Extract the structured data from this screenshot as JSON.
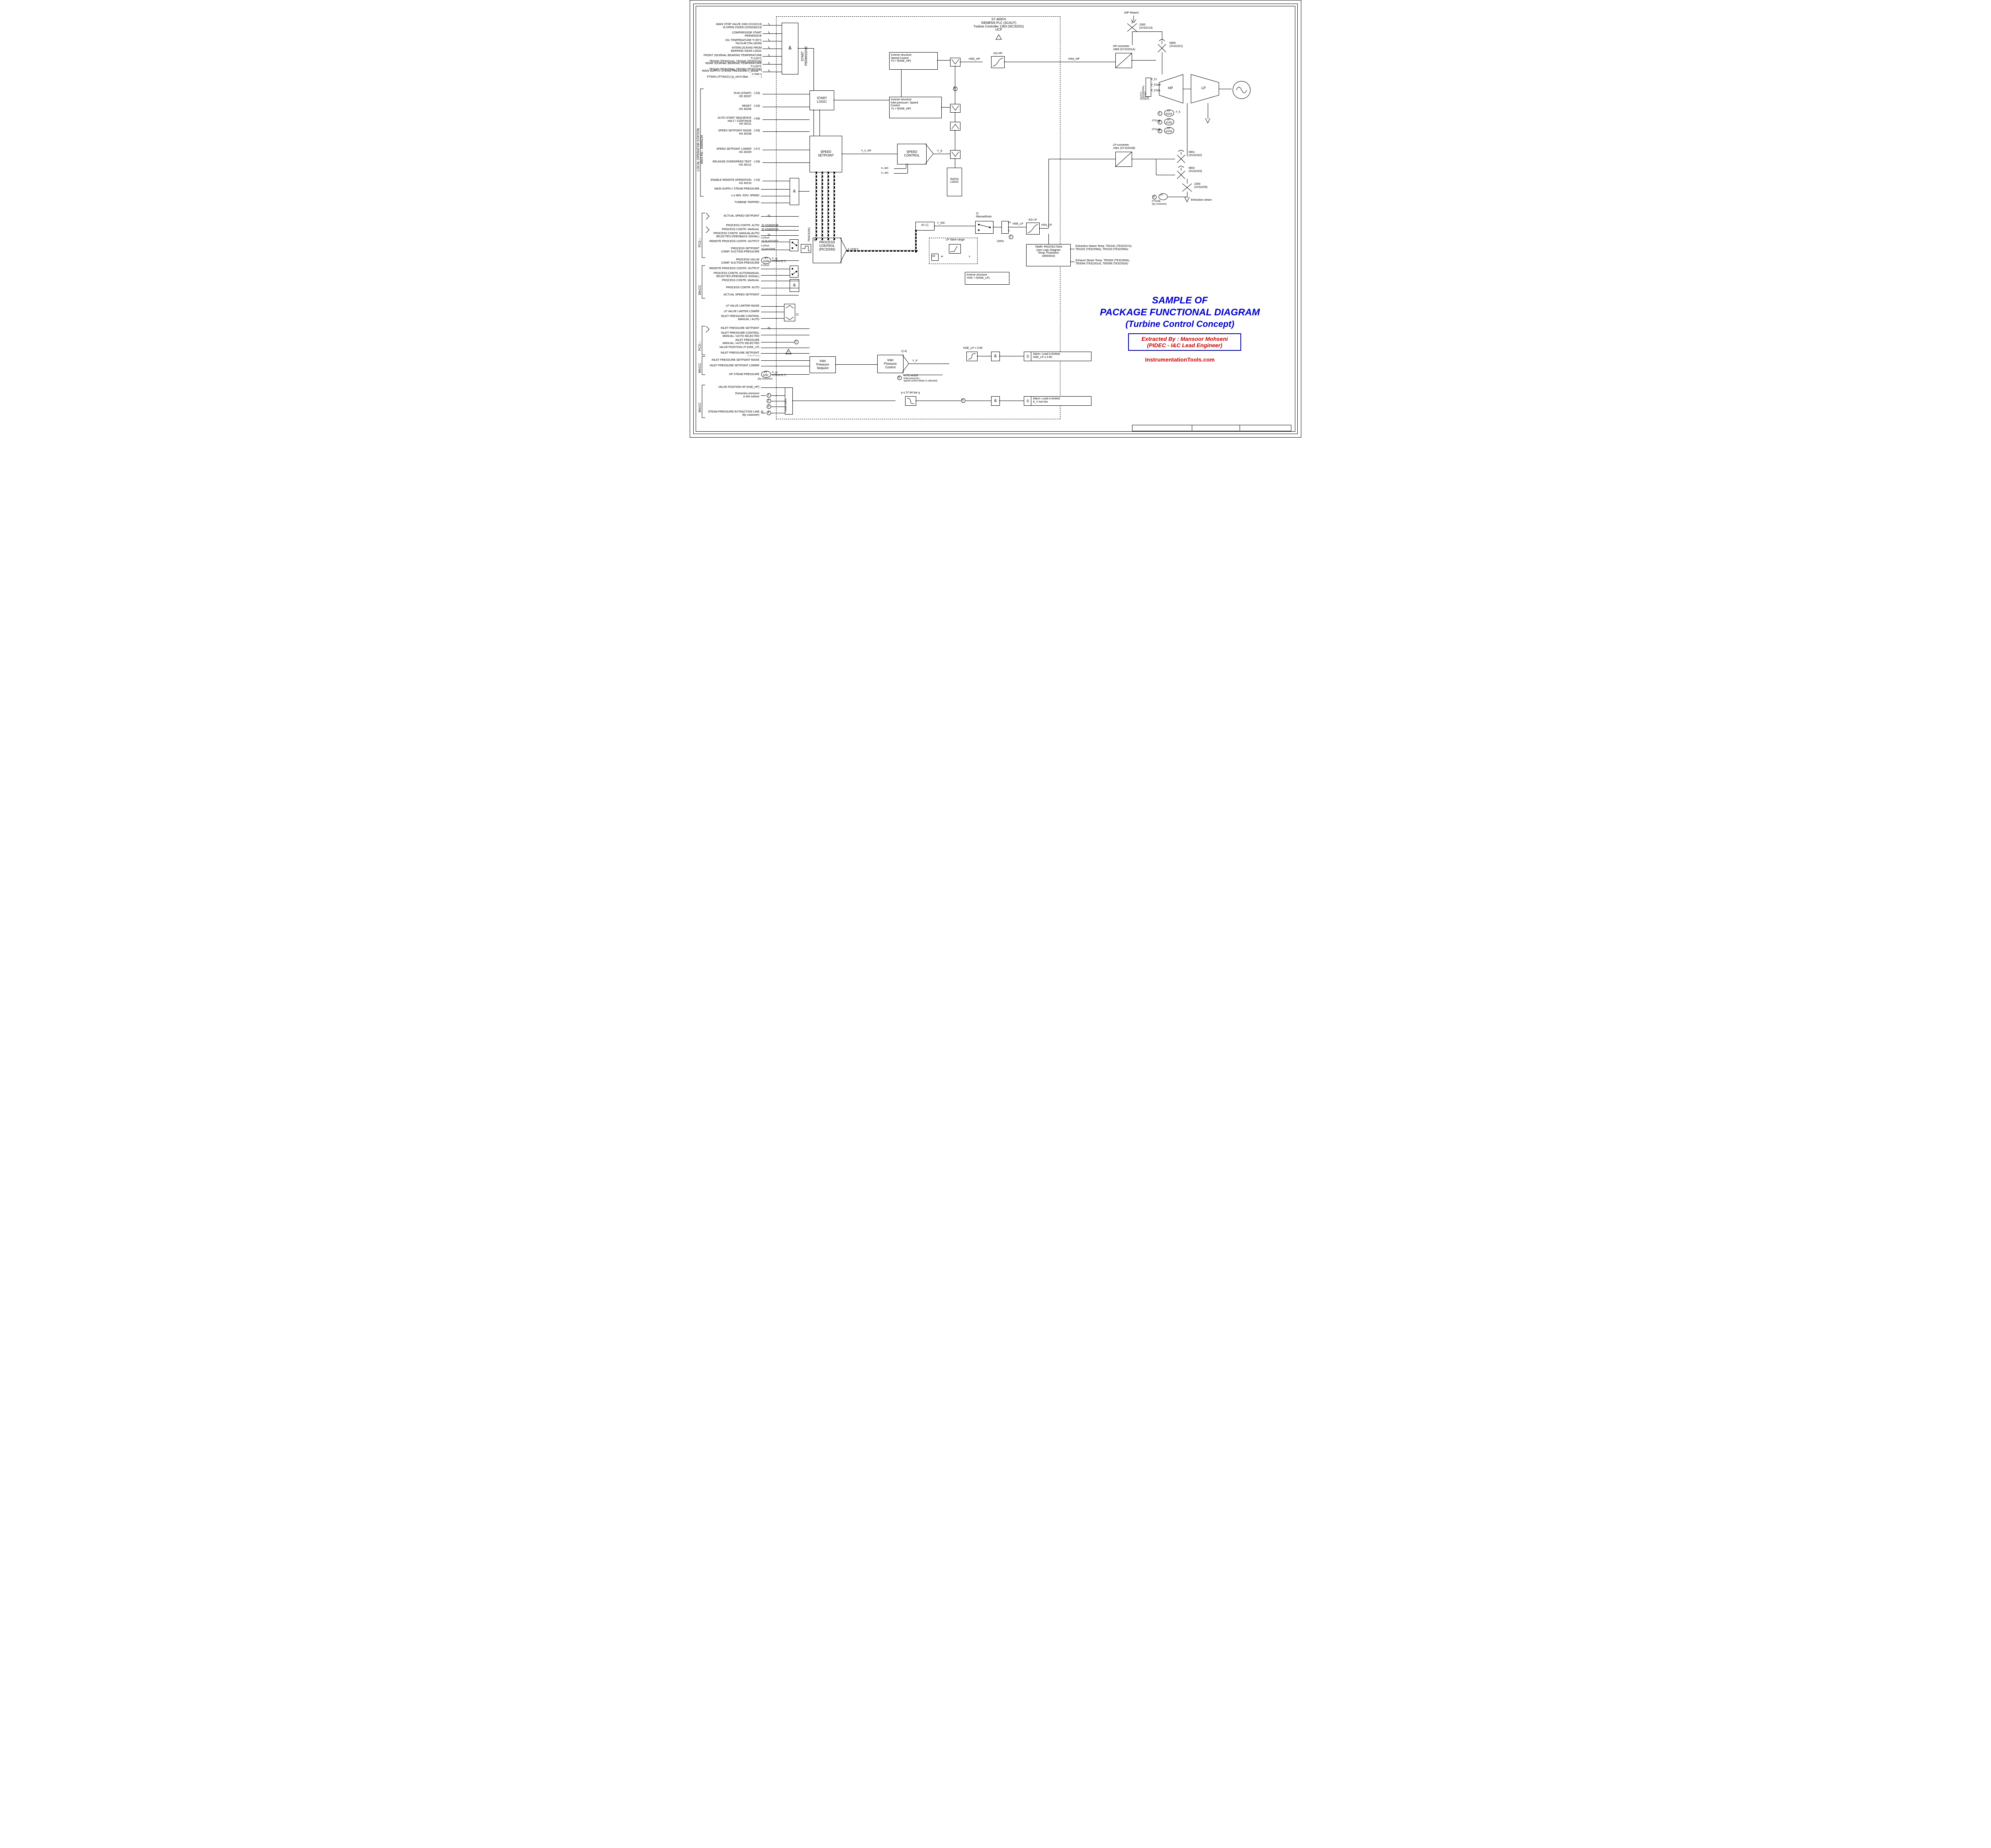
{
  "header": {
    "plc": "S7-400FH",
    "system": "SIEMENS PLC  (SCAUT)",
    "controller": "Turbine Controller 1350  (SIC32201)",
    "ucp": "UCP"
  },
  "permissives": {
    "p1": "MAIN STOP VALVE 2300 (XV32213)\nIS OPEN ZSO05 (XZSO30213)",
    "p2": "COMPRESSOR START\nPERMISSIVE",
    "p3": "OIL TEMPERATURE   T<35°C\nTAL5148  (TAL16249)",
    "p4": "INTERLOCKING FROM\nBARRING GEAR LOGIC",
    "p5": "FRONT JOURNAL BEARING TEMPERATURE   T<120°C\nTE0245 (TE30211A), TE0246 (TE30212A)",
    "p6": "REAR JOURNAL BEARING TEMPERATURE   T<120°C\nTE0249 (TE30209A), TE0250 (TE30210A)",
    "p7": "MAIN SUPPLY STEAM PRESSURE   n_actual * t s·max·s\nPT0001 (PT30221)  (p_rel<0.5bar · · · · · · · )",
    "vtext": "START\nPERMISSIVE"
  },
  "los": {
    "section": "LOCAL OPERATOR STATION",
    "ident": "Ident-No.: 16694216",
    "s1": "RUN (START)\nHS 30207",
    "s1tag": "(-S5)",
    "s2": "RESET\nHS 30206",
    "s2tag": "(-S4)",
    "s3": "AUTO START SEQUENCE\nHALT / CONTINUE\nHS 30211",
    "s3tag": "(-S8)",
    "s4": "SPEED SETPOINT RAISE\nHS 30208",
    "s4tag": "(-S6)",
    "s5": "SPEED SETPOINT LOWER\nHS 30209",
    "s5tag": "(-S7)",
    "s6": "RELEASE OVERSPEED TEST\nHS 30212",
    "s6tag": "(-S9)",
    "s7": "ENABLE REMOTE OPERATION\nHS 30210",
    "s7tag": "(-S3)",
    "mss": "MAIN SUPPLY STEAM PRESSURE",
    "ngov": "n ≥ MIN. GOV. SPEED",
    "trip": "TURBINE TRIPPED"
  },
  "blocks": {
    "start_logic": "START\nLOGIC",
    "speed_setpoint": "SPEED\nSETPOINT",
    "speed_control": "SPEED\nCONTROL",
    "ratio": "RATIO\nLOGIC",
    "hic": "H I C",
    "process_control": "PROCESS\nCONTROL\n(PIC32260)",
    "inlet_setpoint": "Inlet\nPressure\nSetpoint",
    "inlet_control": "Inlet\nPressure\nControl",
    "inv_speed": "Inverse structure\nSpeed Control\nYs = f(HSE_HP)",
    "inv_inlet": "Inverse structure\nInlet pressure / Speed\nControl\nYs = f(HSE_HP)",
    "inv_lp": "Inverse structure\nYHIC = f(HSE_LP)",
    "temp_prot": "TEMP. PROTECTION\n(see Logic Diagram\nTemp. Protection\n16693916)",
    "kg_hp": "KG-HP",
    "kg_lp": "KG-LP",
    "hp_conv": "HP-converter\n1680 (SY32201A)",
    "lp_conv": "LP-converter\n1681 (SY32201B)",
    "lp_valve_range": "LP Valve range",
    "pleast_select": "Pleast select",
    "auto_mode": "AUTO MODE\n(inlet pressure /\nspeed control  Mode is selected)",
    "alarm1": "Alarm: Load is limited;\nHSE_LP ≥ 0.95",
    "alarm2": "Alarm: Load is limited;\nA_V too low",
    "manual_auto": "2)\nManual/Auto",
    "tracking": "TRACKING"
  },
  "pcs": {
    "pcs2": "PCS↑↓",
    "wincc": "WinCC",
    "a1": "ACTUAL SPEED SETPOINT",
    "a2": "PROCESS CONTR. AUTO",
    "a3": "PROCESS CONTR. MANUAL",
    "a4": "PROCESS CONTR. MANUAL/AUTO\nSELECTED (FEEDBACK SIGNAL)",
    "a5": "REMOTE PROCESS CONTR. OUTPUT",
    "a6": "PROCESS SETPOINT\nCOMP. SUCTION PRESSURE",
    "a7": "PROCESS VALUE\nCOMP. SUCTION PRESSURE",
    "a8": "REMOTE PROCESS CONTR. OUTPUT",
    "a9": "PROCESS CONTR. AUTO/MANUAL\nSELECTED (FEEDBACK SIGNAL)",
    "a10": "PROCESS CONTR. MANUAL",
    "a11": "PROCESS CONTR. AUTO",
    "a12": "ACTUAL SPEED SETPOINT",
    "a2tag": "5) XS30257B",
    "a3tag": "5) XS30257A",
    "a5tag": "5) 9) HY3207",
    "a6tag": "5) HY3206",
    "a7tag_pt": "PT\n30266",
    "a7tag_txt": "P_sp\n4-20mA   5) 7)",
    "sig_420": "4-20mA"
  },
  "lp": {
    "l1": "LP VALVE LIMITER RAISE",
    "l2": "LP VALVE LIMITER LOWER",
    "l3": "INLET PRESSURE CONTROL\nMANUAL / AUTO",
    "l4": "INLET PRESSURE SETPOINT",
    "l5": "INLET PRESSURE CONTROL\nMANUAL / AUTO SELECTED",
    "l6": "INLET PRESSURE\nMANUAL / AUTO SELECTED",
    "l7": "VALVE POSITION LP (HSE_LP)",
    "l8": "INLET PRESSURE SETPOINT",
    "l8sub": "(Inlet Press)",
    "l9": "INLET PRESSURE SETPOINT RAISE",
    "l10": "INLET PRESSURE SETPOINT LOWER",
    "l11": "HP STEAM PRESSURE",
    "l11pt": "PT\n3250",
    "l11sub": "(by customer)",
    "l11sig": "P_sp\n4-20mA   5) 7)"
  },
  "ext": {
    "v1": "VALVE POSITION HP (HSE_HP)",
    "v2": "Extraction pressure\nin the turbine",
    "v3": "STEAM PRESSURE EXTRACTION LINE\n(by customer)",
    "bar": "p ≤ 37.84 bar g"
  },
  "right": {
    "hp_steam": "(HP-Steam)",
    "xv2300": "2300\n(XV32213)",
    "sv0800": "0800\n(SV32201)",
    "sv0801": "0801\n(SV32202)",
    "sv0802": "0802\n(SV32203)",
    "xv2350": "2350\n(XV32205)",
    "ext_steam": "Extraction steam",
    "pe1": "P_E1",
    "pe2": "P_E2WK",
    "pe3": "P_E2WL",
    "se": "SE/PLC\n(SE030200A)\nSE0262\n(SE030200B)",
    "hp": "HP",
    "lp_lbl": "LP",
    "pt1": "PT\n30254",
    "pt1n": "1",
    "pt1e": "P_E",
    "pt2": "PT\n30255",
    "pt2n": "2",
    "pt3": "PT\n30256",
    "pt3n": "3",
    "pt0162": "PT0162",
    "pt0163": "PT0163",
    "pt0256": "PT0256\n(by customer)",
    "pt0256n": "4",
    "ext_temp": "Extraction Steam Temp. TE0161 (TE32257A),\nTE0162 (TE32258A), TE0163 (TE32259A)",
    "exh_temp": "Exhaust Steam Temp. TE0093 (TE32260A),\nTE0094 (TE32261A), TE0095 (TE32262A)"
  },
  "labels": {
    "hse_hp": "HSE_HP",
    "hsa_hp": "HSA_HP",
    "hse_lp": "HSE_LP",
    "hsa_lp": "HSA_LP",
    "hse_095": "HSE_LP = 0.95",
    "ys": "Y_S",
    "yhic": "Y_HIC",
    "yp": "Y_P",
    "n1": "n₁ act",
    "n2": "n₂ act",
    "n_s_set": "n_s_set",
    "one": "1",
    "two": "2",
    "three": "3",
    "four": "4",
    "five": "5",
    "six": "6",
    "note_24": "2)  4)",
    "note_8": "8)",
    "note_2": "2)",
    "note_6": "6)",
    "note_5": "5)",
    "h": "H",
    "s": "S",
    "l": "L",
    "w": "w",
    "x": "x",
    "x0": "x0",
    "const_100": "100%"
  },
  "watermark": {
    "l1": "SAMPLE OF",
    "l2": "PACKAGE FUNCTIONAL DIAGRAM",
    "l3": "(Turbine Control Concept)",
    "b1": "Extracted By : Mansoor Mohseni",
    "b2": "(PIDEC - I&C Lead Engineer)",
    "site": "InstrumentationTools.com"
  }
}
